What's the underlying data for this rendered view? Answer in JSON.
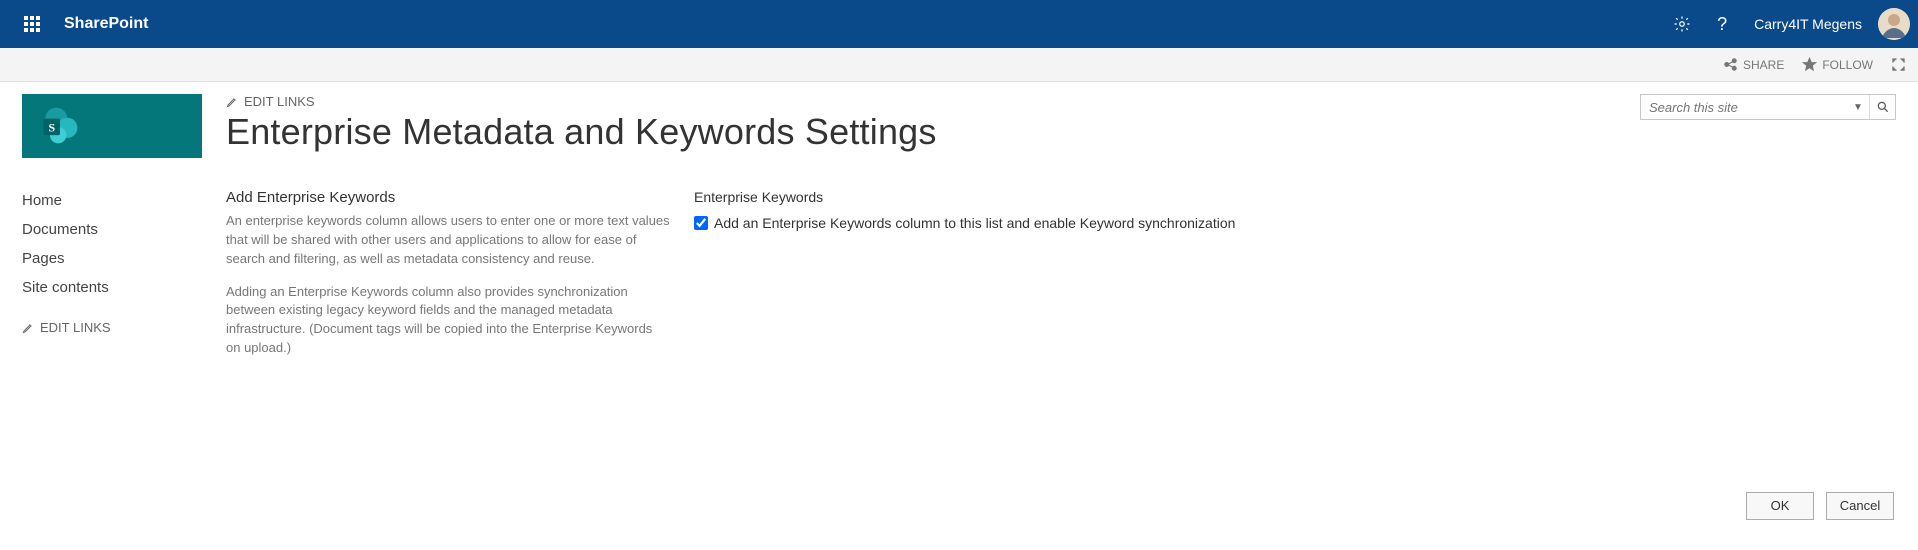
{
  "suite": {
    "product": "SharePoint",
    "user_name": "Carry4IT Megens"
  },
  "ribbon": {
    "share": "SHARE",
    "follow": "FOLLOW"
  },
  "top_nav": {
    "edit_links": "EDIT LINKS"
  },
  "page": {
    "title": "Enterprise Metadata and Keywords Settings"
  },
  "left_nav": {
    "items": [
      "Home",
      "Documents",
      "Pages",
      "Site contents"
    ],
    "edit_links": "EDIT LINKS"
  },
  "search": {
    "placeholder": "Search this site"
  },
  "section": {
    "heading": "Add Enterprise Keywords",
    "para1": "An enterprise keywords column allows users to enter one or more text values that will be shared with other users and applications to allow for ease of search and filtering, as well as metadata consistency and reuse.",
    "para2": "Adding an Enterprise Keywords column also provides synchronization between existing legacy keyword fields and the managed metadata infrastructure. (Document tags will be copied into the Enterprise Keywords on upload.)"
  },
  "form": {
    "group_label": "Enterprise Keywords",
    "checkbox_label": "Add an Enterprise Keywords column to this list and enable Keyword synchronization",
    "checkbox_checked": true
  },
  "buttons": {
    "ok": "OK",
    "cancel": "Cancel"
  }
}
